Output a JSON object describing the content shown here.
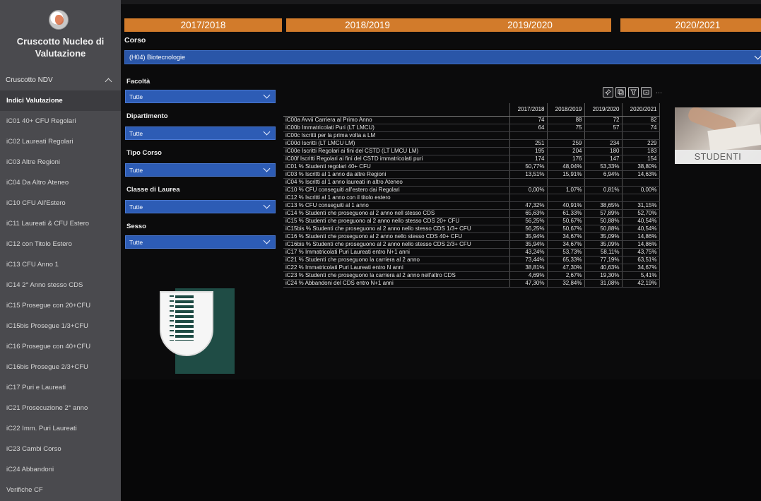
{
  "app": {
    "title": "Cruscotto Nucleo di Valutazione"
  },
  "sidebar": {
    "section": "Cruscotto NDV",
    "items": [
      {
        "label": "Indici Valutazione",
        "active": true
      },
      {
        "label": "iC01 40+ CFU Regolari"
      },
      {
        "label": "iC02 Laureati Regolari"
      },
      {
        "label": "iC03 Altre Regioni"
      },
      {
        "label": "iC04 Da Altro Ateneo"
      },
      {
        "label": "iC10 CFU All'Estero"
      },
      {
        "label": "iC11 Laureati & CFU Estero"
      },
      {
        "label": "iC12 con Titolo Estero"
      },
      {
        "label": "iC13 CFU Anno 1"
      },
      {
        "label": "iC14 2° Anno stesso CDS"
      },
      {
        "label": "iC15 Prosegue con 20+CFU"
      },
      {
        "label": "iC15bis Prosegue 1/3+CFU"
      },
      {
        "label": "iC16 Prosegue con 40+CFU"
      },
      {
        "label": "iC16bis Prosegue 2/3+CFU"
      },
      {
        "label": "iC17 Puri e Laureati"
      },
      {
        "label": "iC21 Prosecuzione 2° anno"
      },
      {
        "label": "iC22 Imm. Puri Laureati"
      },
      {
        "label": "iC23 Cambi Corso"
      },
      {
        "label": "iC24 Abbandoni"
      },
      {
        "label": "Verifiche CF"
      }
    ]
  },
  "years": [
    "2017/2018",
    "2018/2019",
    "2019/2020",
    "2020/2021"
  ],
  "corso": {
    "label": "Corso",
    "value": "(H04) Biotecnologie"
  },
  "filters": [
    {
      "label": "Facoltà",
      "value": "Tutte"
    },
    {
      "label": "Dipartimento",
      "value": "Tutte"
    },
    {
      "label": "Tipo Corso",
      "value": "Tutte"
    },
    {
      "label": "Classe di Laurea",
      "value": "Tutte"
    },
    {
      "label": "Sesso",
      "value": "Tutte"
    }
  ],
  "toolbar_icons": [
    "pin-icon",
    "copy-icon",
    "filter-icon",
    "focus-icon",
    "more-icon"
  ],
  "more_glyph": "···",
  "table": {
    "columns": [
      "2017/2018",
      "2018/2019",
      "2019/2020",
      "2020/2021"
    ],
    "rows": [
      {
        "label": "iC00a Avvii Carriera al Primo Anno",
        "values": [
          "74",
          "88",
          "72",
          "82"
        ]
      },
      {
        "label": "iC00b Immatricolati Puri (LT LMCU)",
        "values": [
          "64",
          "75",
          "57",
          "74"
        ]
      },
      {
        "label": "iC00c Iscritti per la prima volta a LM",
        "values": [
          "",
          "",
          "",
          ""
        ]
      },
      {
        "label": "iC00d Iscritti (LT LMCU LM)",
        "values": [
          "251",
          "259",
          "234",
          "229"
        ]
      },
      {
        "label": "iC00e Iscritti Regolari ai fini del CSTD (LT LMCU LM)",
        "values": [
          "195",
          "204",
          "180",
          "183"
        ]
      },
      {
        "label": "iC00f Iscritti Regolari ai fini del CSTD immatricolati puri",
        "values": [
          "174",
          "176",
          "147",
          "154"
        ]
      },
      {
        "label": "iC01 % Studenti regolari  40+ CFU",
        "values": [
          "50,77%",
          "48,04%",
          "53,33%",
          "38,80%"
        ]
      },
      {
        "label": "iC03 % Iscritti al 1 anno da altre Regioni",
        "values": [
          "13,51%",
          "15,91%",
          "6,94%",
          "14,63%"
        ]
      },
      {
        "label": "iC04 % Iscritti al 1 anno laureati in altro Ateneo",
        "values": [
          "",
          "",
          "",
          ""
        ]
      },
      {
        "label": "iC10 % CFU conseguiti all'estero dai Regolari",
        "values": [
          "0,00%",
          "1,07%",
          "0,81%",
          "0,00%"
        ]
      },
      {
        "label": "iC12 % Iscritti al 1 anno con il titolo estero",
        "values": [
          "",
          "",
          "",
          ""
        ]
      },
      {
        "label": "iC13 % CFU conseguiti al 1 anno",
        "values": [
          "47,32%",
          "40,91%",
          "38,65%",
          "31,15%"
        ]
      },
      {
        "label": "iC14  % Studenti che proseguono al 2 anno nell stesso CDS",
        "values": [
          "65,63%",
          "61,33%",
          "57,89%",
          "52,70%"
        ]
      },
      {
        "label": "iC15 % Studenti che proeguono al 2 anno nello stesso CDS 20+ CFU",
        "values": [
          "56,25%",
          "50,67%",
          "50,88%",
          "40,54%"
        ]
      },
      {
        "label": "iC15bis  % Studenti che proseguono al 2 anno nello stesso CDS 1/3+ CFU",
        "values": [
          "56,25%",
          "50,67%",
          "50,88%",
          "40,54%"
        ]
      },
      {
        "label": "iC16 % Studenti che proseguono al 2 anno nello stesso CDS 40+ CFU",
        "values": [
          "35,94%",
          "34,67%",
          "35,09%",
          "14,86%"
        ]
      },
      {
        "label": "iC16bis  % Studenti che proseguono al 2 anno nello stesso CDS 2/3+ CFU",
        "values": [
          "35,94%",
          "34,67%",
          "35,09%",
          "14,86%"
        ]
      },
      {
        "label": "iC17 % Immatricolati Puri Laureati entro N+1 anni",
        "values": [
          "43,24%",
          "53,73%",
          "58,11%",
          "43,75%"
        ]
      },
      {
        "label": "iC21 % Studenti che proseguono la carriera al 2 anno",
        "values": [
          "73,44%",
          "65,33%",
          "77,19%",
          "63,51%"
        ]
      },
      {
        "label": "iC22 % Immatricolati Puri Laureati entro N anni",
        "values": [
          "38,81%",
          "47,30%",
          "40,63%",
          "34,67%"
        ]
      },
      {
        "label": "iC23 % Studenti che proseguono la carriera al 2 anno nell'altro CDS",
        "values": [
          "4,69%",
          "2,67%",
          "19,30%",
          "5,41%"
        ]
      },
      {
        "label": "iC24 % Abbandoni del CDS entro N+1 anni",
        "values": [
          "47,30%",
          "32,84%",
          "31,08%",
          "42,19%"
        ]
      }
    ]
  },
  "studenti": {
    "label": "STUDENTI"
  }
}
